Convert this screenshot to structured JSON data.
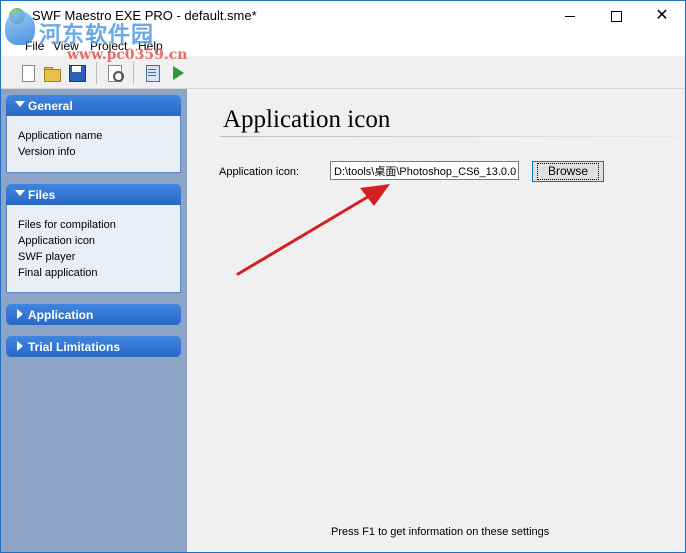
{
  "window": {
    "title": "SWF Maestro EXE PRO - default.sme*",
    "buttons": {
      "minimize": "minimize-icon",
      "maximize": "maximize-icon",
      "close": "✕"
    }
  },
  "watermark": {
    "line1": "河东软件园",
    "line2": "www.pc0359.cn"
  },
  "menu": {
    "file": "File",
    "view": "View",
    "project": "Project",
    "help": "Help"
  },
  "toolbar": {
    "icons": [
      "new-file-icon",
      "open-folder-icon",
      "save-disk-icon",
      "preview-icon",
      "build-icon",
      "run-icon"
    ]
  },
  "sidebar": {
    "general": {
      "title": "General",
      "items": [
        "Application name",
        "Version info"
      ]
    },
    "files": {
      "title": "Files",
      "items": [
        "Files for compilation",
        "Application icon",
        "SWF player",
        "Final application"
      ]
    },
    "application": {
      "title": "Application"
    },
    "trial": {
      "title": "Trial Limitations"
    }
  },
  "main": {
    "heading": "Application icon",
    "field_label": "Application icon:",
    "field_value": "D:\\tools\\桌面\\Photoshop_CS6_13.0.0",
    "browse_label": "Browse",
    "status": "Press F1 to get information on these settings"
  },
  "colors": {
    "accent": "#2a68c6",
    "sidebar_bg": "#8ea4c7",
    "annotation_arrow": "#d42020"
  }
}
